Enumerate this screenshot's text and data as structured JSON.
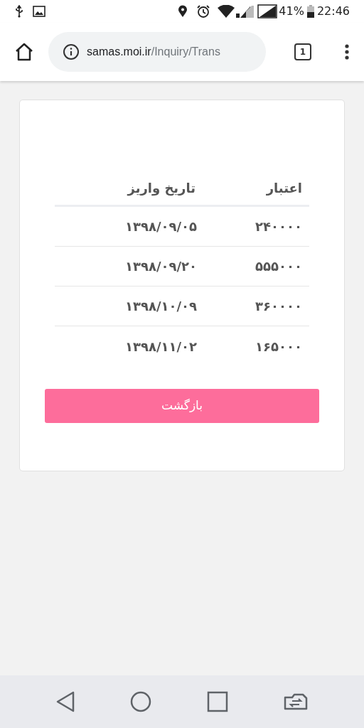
{
  "status_bar": {
    "battery": "41%",
    "time": "22:46"
  },
  "browser": {
    "url_host": "samas.moi.ir",
    "url_path": "/Inquiry/Trans",
    "tab_count": "1"
  },
  "table": {
    "columns": [
      "اعتبار",
      "تاریخ واریز"
    ],
    "rows": [
      [
        "۲۴۰۰۰۰",
        "۱۳۹۸/۰۹/۰۵"
      ],
      [
        "۵۵۵۰۰۰",
        "۱۳۹۸/۰۹/۲۰"
      ],
      [
        "۳۶۰۰۰۰",
        "۱۳۹۸/۱۰/۰۹"
      ],
      [
        "۱۶۵۰۰۰",
        "۱۳۹۸/۱۱/۰۲"
      ]
    ]
  },
  "back_button": "بازگشت"
}
